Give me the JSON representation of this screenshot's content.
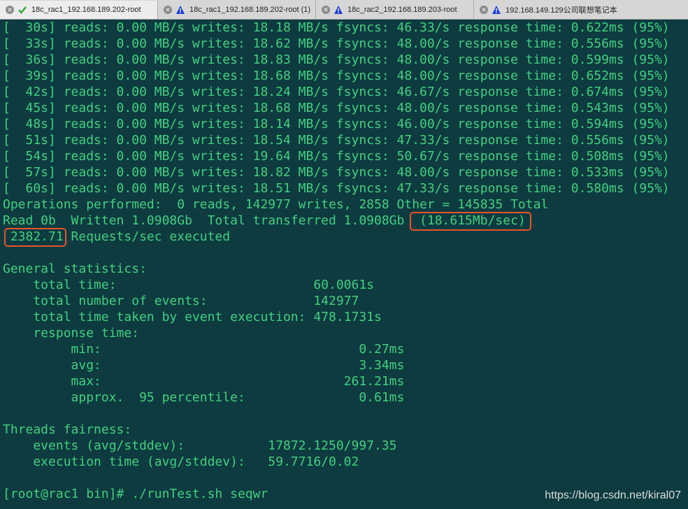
{
  "tabs": [
    {
      "title": "18c_rac1_192.168.189.202-root",
      "status": "connected"
    },
    {
      "title": "18c_rac1_192.168.189.202-root (1)",
      "status": "warning"
    },
    {
      "title": "18c_rac2_192.168.189.203-root",
      "status": "warning"
    },
    {
      "title": "192.168.149.129公司联想笔记本",
      "status": "warning"
    }
  ],
  "colors": {
    "terminal_bg": "#0d3b40",
    "terminal_text": "#43cf7f",
    "highlight": "#e8542a",
    "ok": "#2fa33a",
    "warning": "#1f3fd6"
  },
  "terminal": {
    "lines": [
      "[  30s] reads: 0.00 MB/s writes: 18.18 MB/s fsyncs: 46.33/s response time: 0.622ms (95%)",
      "[  33s] reads: 0.00 MB/s writes: 18.62 MB/s fsyncs: 48.00/s response time: 0.556ms (95%)",
      "[  36s] reads: 0.00 MB/s writes: 18.83 MB/s fsyncs: 48.00/s response time: 0.599ms (95%)",
      "[  39s] reads: 0.00 MB/s writes: 18.68 MB/s fsyncs: 48.00/s response time: 0.652ms (95%)",
      "[  42s] reads: 0.00 MB/s writes: 18.24 MB/s fsyncs: 46.67/s response time: 0.674ms (95%)",
      "[  45s] reads: 0.00 MB/s writes: 18.68 MB/s fsyncs: 48.00/s response time: 0.543ms (95%)",
      "[  48s] reads: 0.00 MB/s writes: 18.14 MB/s fsyncs: 46.00/s response time: 0.594ms (95%)",
      "[  51s] reads: 0.00 MB/s writes: 18.54 MB/s fsyncs: 47.33/s response time: 0.556ms (95%)",
      "[  54s] reads: 0.00 MB/s writes: 19.64 MB/s fsyncs: 50.67/s response time: 0.508ms (95%)",
      "[  57s] reads: 0.00 MB/s writes: 18.82 MB/s fsyncs: 48.00/s response time: 0.533ms (95%)",
      "[  60s] reads: 0.00 MB/s writes: 18.51 MB/s fsyncs: 47.33/s response time: 0.580ms (95%)",
      "Operations performed:  0 reads, 142977 writes, 2858 Other = 145835 Total",
      "Read 0b  Written 1.0908Gb  Total transferred 1.0908Gb  (18.615Mb/sec)",
      " 2382.71 Requests/sec executed",
      "",
      "General statistics:",
      "    total time:                          60.0061s",
      "    total number of events:              142977",
      "    total time taken by event execution: 478.1731s",
      "    response time:",
      "         min:                                  0.27ms",
      "         avg:                                  3.34ms",
      "         max:                                261.21ms",
      "         approx.  95 percentile:               0.61ms",
      "",
      "Threads fairness:",
      "    events (avg/stddev):           17872.1250/997.35",
      "    execution time (avg/stddev):   59.7716/0.02",
      "",
      "[root@rac1 bin]# ./runTest.sh seqwr"
    ]
  },
  "watermark": "https://blog.csdn.net/kiral07"
}
